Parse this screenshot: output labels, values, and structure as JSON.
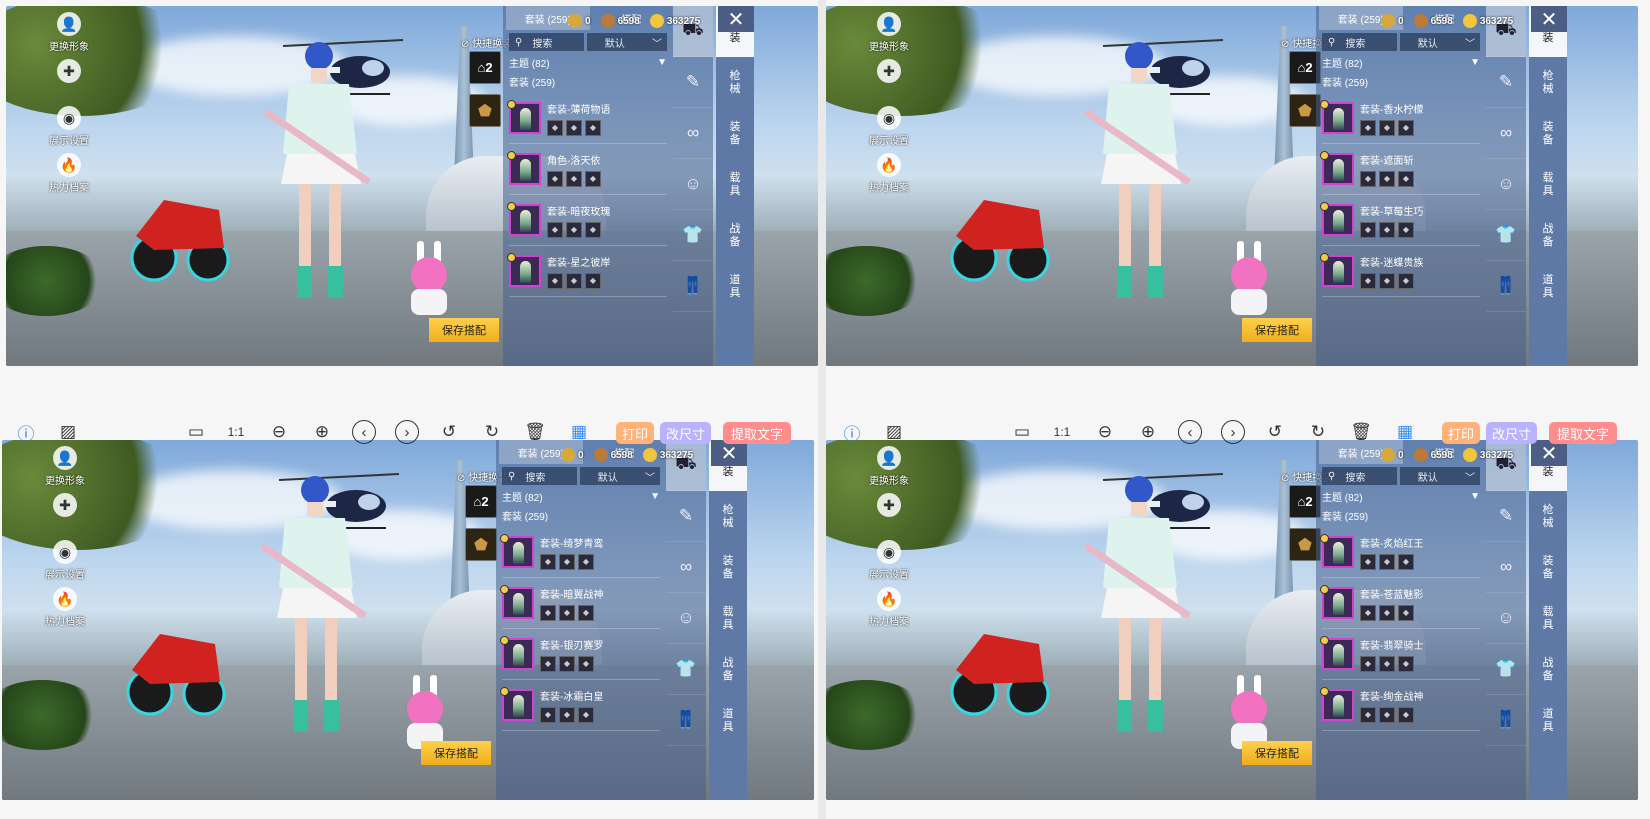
{
  "common": {
    "qs_label": "快捷换装",
    "tabs": [
      "套装 (259)",
      "搭配"
    ],
    "search_label": "搜索",
    "sort_label": "默认",
    "topic": "主题 (82)",
    "suit_count": "套装 (259)",
    "save_label": "保存搭配",
    "left_menu": [
      "更换形象",
      "",
      "展示设置",
      "热力档案"
    ],
    "vertical_tabs": [
      "时装",
      "枪械",
      "装备",
      "载具",
      "战备",
      "道具"
    ],
    "currency": [
      "0",
      "6598",
      "363275"
    ],
    "close": "✕",
    "rack_number": "2"
  },
  "screens": [
    {
      "items": [
        "套装-薄荷物语",
        "角色-洛天依",
        "套装-暗夜玫瑰",
        "套装-星之彼岸"
      ]
    },
    {
      "items": [
        "套装-香水柠檬",
        "套装-遮面斩",
        "套装-草莓生巧",
        "套装-迷蝶贵族"
      ]
    },
    {
      "items": [
        "套装-绮梦青鸾",
        "套装-暗翼战神",
        "套装-银刃赛罗",
        "套装-冰霜白皇"
      ]
    },
    {
      "items": [
        "套装-炙焰红王",
        "套装-苍蓝魅影",
        "套装-翡翠骑士",
        "套装-绚金战神"
      ]
    }
  ],
  "toolbar": {
    "icons": [
      "info-icon",
      "image-icon",
      "monitor-icon",
      "one-to-one-icon",
      "zoom-out-icon",
      "zoom-in-icon",
      "prev-icon",
      "next-icon",
      "rotate-left-icon",
      "rotate-right-icon",
      "delete-icon",
      "grid-icon"
    ],
    "glyphs": [
      "ⓘ",
      "▨",
      "▭",
      "1:1",
      "⊖",
      "⊕",
      "‹",
      "›",
      "↺",
      "↻",
      "🗑",
      "▦"
    ],
    "print": "打印",
    "resize": "改尺寸",
    "ocr": "提取文字",
    "print_color": "#ffb27a",
    "resize_color": "#b9b2ff",
    "ocr_color": "#ff8d8d",
    "info_color": "#2f7fe8",
    "grid_color": "#2f8cf2"
  }
}
